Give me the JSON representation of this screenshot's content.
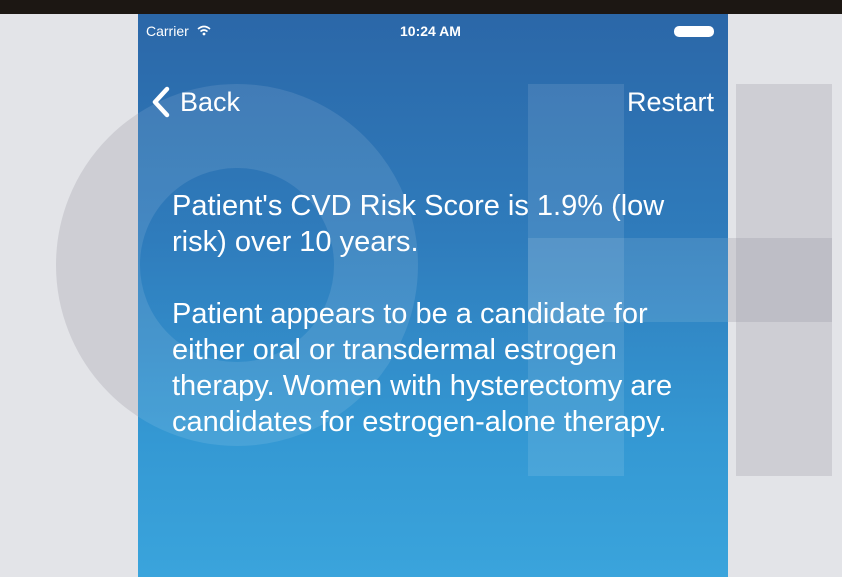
{
  "status_bar": {
    "carrier": "Carrier",
    "wifi_icon": "wifi-icon",
    "time": "10:24 AM",
    "battery_icon": "battery-icon"
  },
  "nav": {
    "back_label": "Back",
    "back_icon": "chevron-left-icon",
    "restart_label": "Restart"
  },
  "content": {
    "risk_text": "Patient's CVD Risk Score is 1.9% (low risk) over 10 years.",
    "recommendation_text": "Patient appears to be a candidate for either oral or transdermal estrogen therapy. Women with hysterectomy are candidates for estrogen-alone therapy."
  },
  "colors": {
    "gradient_top": "#2b67a8",
    "gradient_bottom": "#3aa4dc",
    "text": "#ffffff",
    "page_background": "#e3e4e8"
  }
}
